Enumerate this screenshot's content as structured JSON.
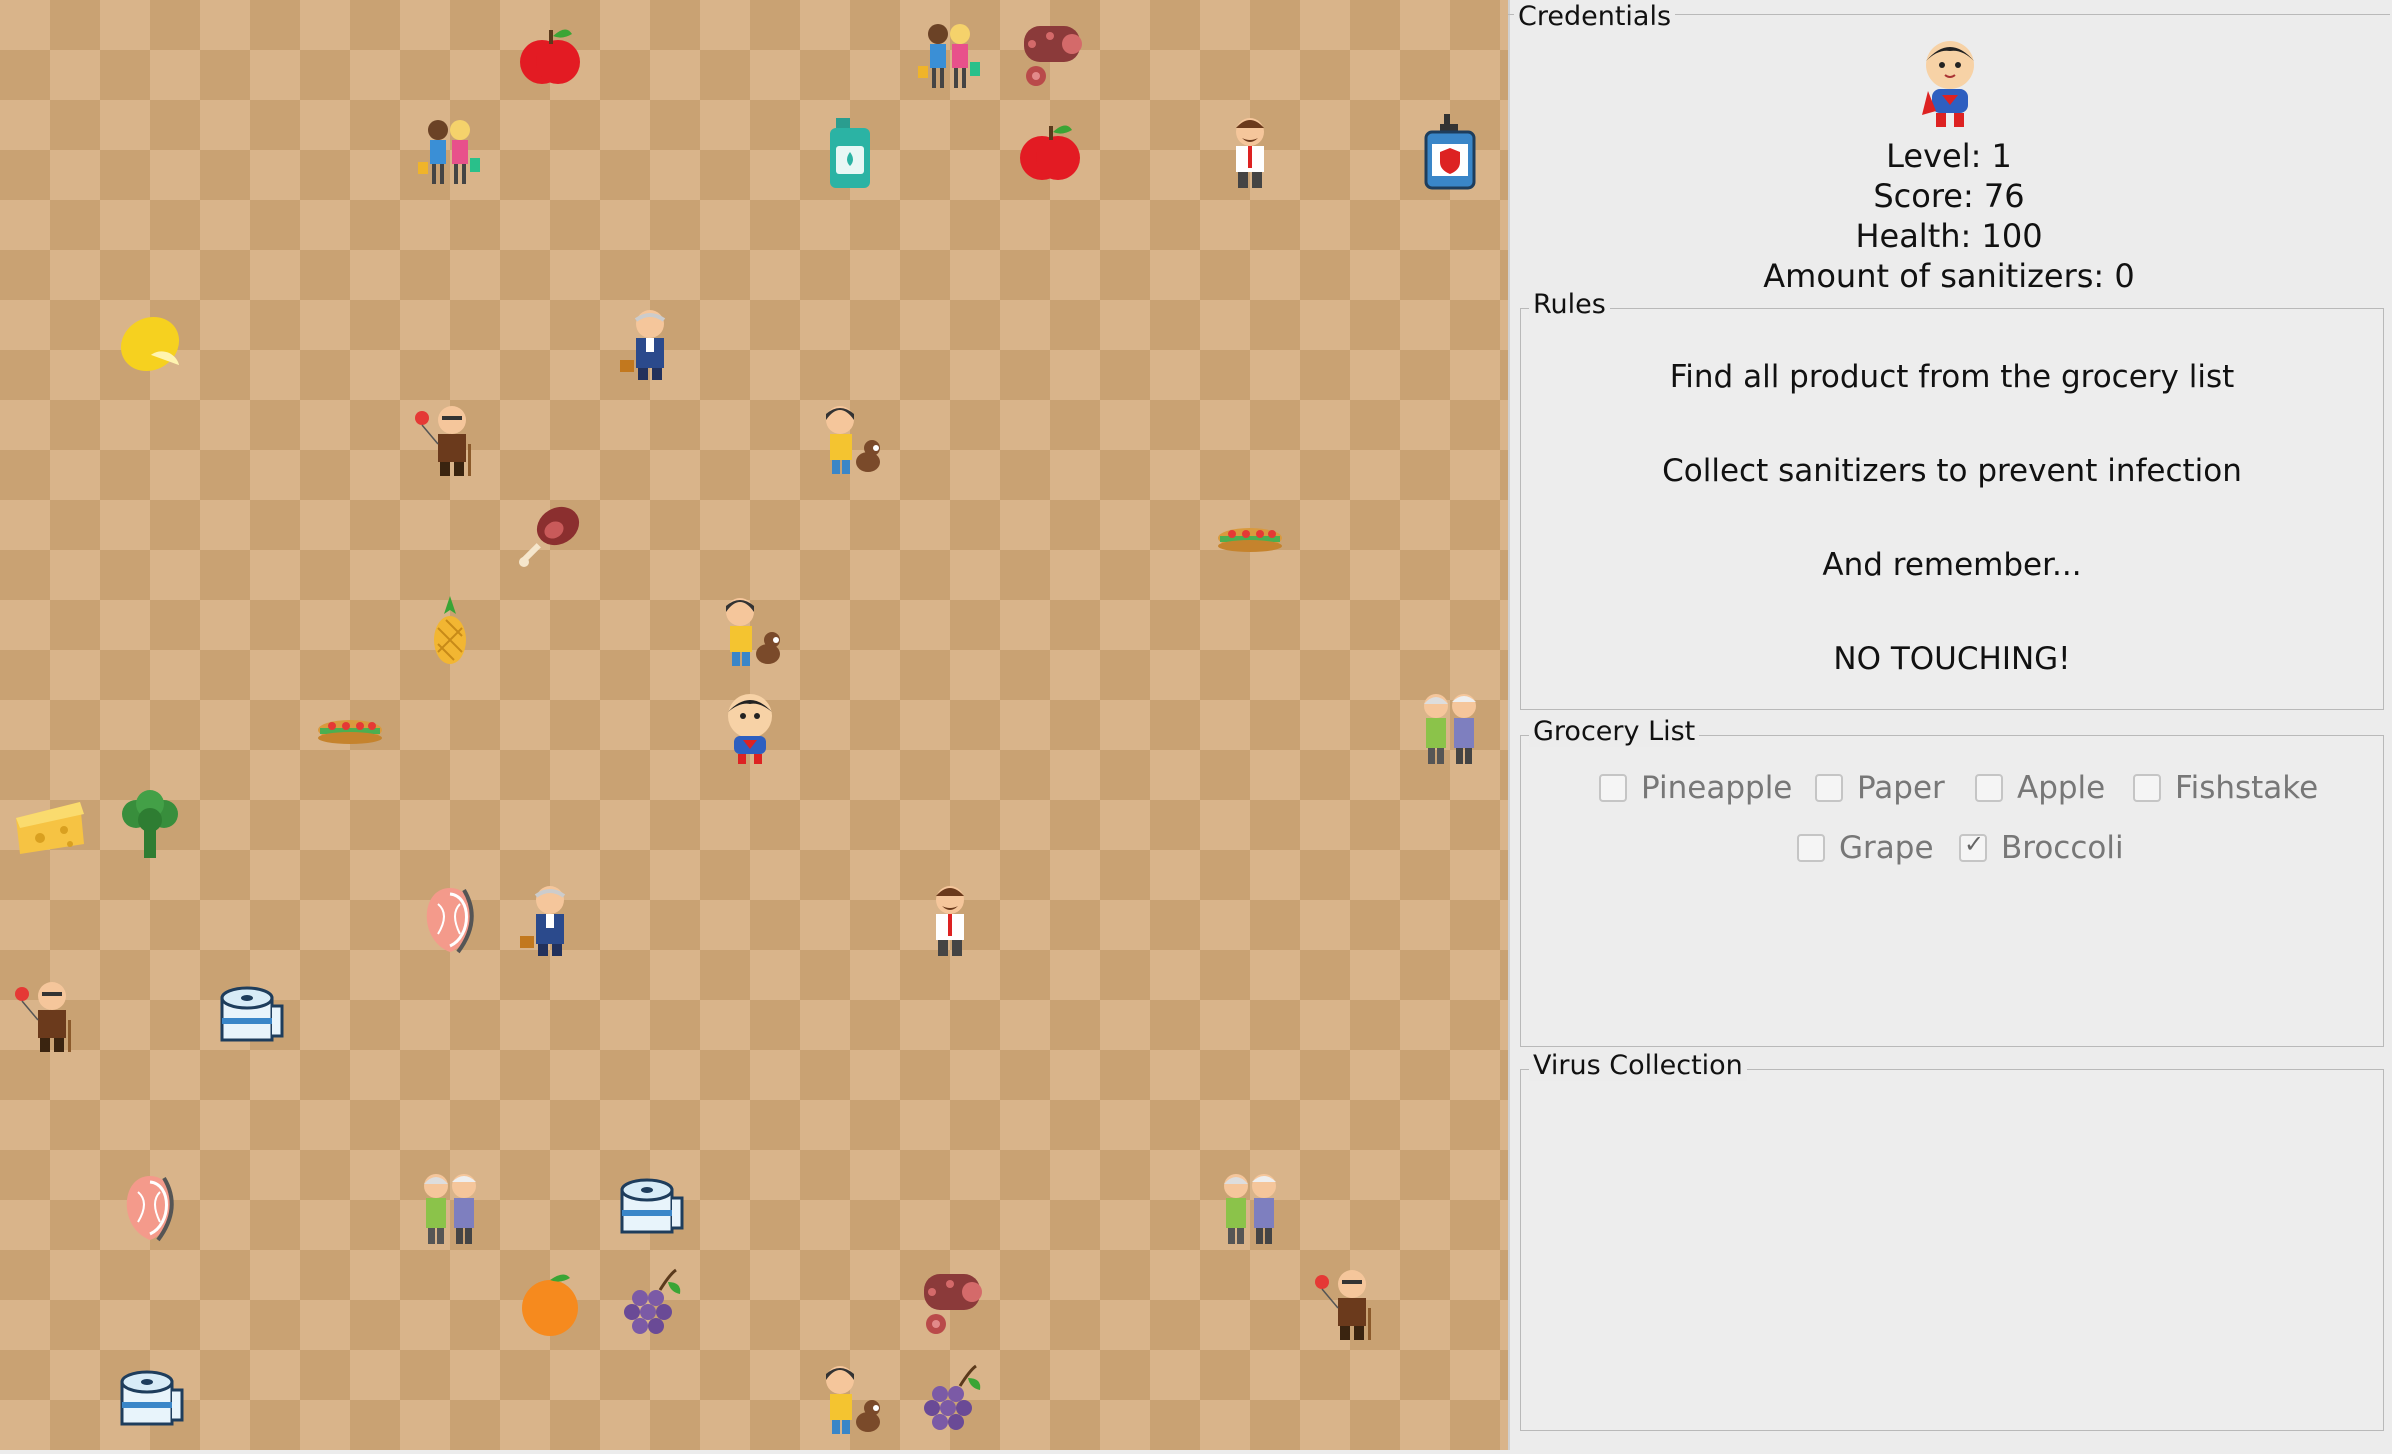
{
  "board": {
    "tiles": [
      {
        "type": "apple-icon",
        "col": 5,
        "row": 0
      },
      {
        "type": "shoppers-icon",
        "col": 9,
        "row": 0
      },
      {
        "type": "salami-icon",
        "col": 10,
        "row": 0
      },
      {
        "type": "shoppers-icon",
        "col": 4,
        "row": 1
      },
      {
        "type": "sanitizer-bottle-icon",
        "col": 8,
        "row": 1
      },
      {
        "type": "apple-icon",
        "col": 10,
        "row": 1
      },
      {
        "type": "man-mustache-icon",
        "col": 12,
        "row": 1
      },
      {
        "type": "sanitizer-spray-icon",
        "col": 14,
        "row": 1
      },
      {
        "type": "lemon-icon",
        "col": 1,
        "row": 3
      },
      {
        "type": "old-man-briefcase-icon",
        "col": 6,
        "row": 3
      },
      {
        "type": "grandpa-balloon-icon",
        "col": 4,
        "row": 4
      },
      {
        "type": "girl-dog-icon",
        "col": 8,
        "row": 4
      },
      {
        "type": "ham-icon",
        "col": 5,
        "row": 5
      },
      {
        "type": "sandwich-icon",
        "col": 12,
        "row": 5
      },
      {
        "type": "pineapple-icon",
        "col": 4,
        "row": 6
      },
      {
        "type": "girl-dog-icon",
        "col": 7,
        "row": 6
      },
      {
        "type": "sandwich-icon",
        "col": 3,
        "row": 7
      },
      {
        "type": "player-hero-icon",
        "col": 7,
        "row": 7
      },
      {
        "type": "elderly-couple-icon",
        "col": 14,
        "row": 7
      },
      {
        "type": "cheese-icon",
        "col": 0,
        "row": 8
      },
      {
        "type": "broccoli-icon",
        "col": 1,
        "row": 8
      },
      {
        "type": "fish-steak-icon",
        "col": 4,
        "row": 9
      },
      {
        "type": "old-man-briefcase-icon",
        "col": 5,
        "row": 9
      },
      {
        "type": "man-mustache-icon",
        "col": 9,
        "row": 9
      },
      {
        "type": "grandpa-balloon-icon",
        "col": 0,
        "row": 10
      },
      {
        "type": "toilet-paper-icon",
        "col": 2,
        "row": 10
      },
      {
        "type": "fish-steak-icon",
        "col": 1,
        "row": 12
      },
      {
        "type": "elderly-couple-icon",
        "col": 4,
        "row": 12
      },
      {
        "type": "toilet-paper-icon",
        "col": 6,
        "row": 12
      },
      {
        "type": "elderly-couple-icon",
        "col": 12,
        "row": 12
      },
      {
        "type": "orange-icon",
        "col": 5,
        "row": 13
      },
      {
        "type": "grapes-icon",
        "col": 6,
        "row": 13
      },
      {
        "type": "salami-icon",
        "col": 9,
        "row": 13
      },
      {
        "type": "grandpa-balloon-icon",
        "col": 13,
        "row": 13
      },
      {
        "type": "toilet-paper-icon",
        "col": 1,
        "row": 14
      },
      {
        "type": "girl-dog-icon",
        "col": 8,
        "row": 14
      },
      {
        "type": "grapes-icon",
        "col": 9,
        "row": 14
      }
    ]
  },
  "credentials": {
    "legend": "Credentials",
    "avatar_icon": "player-hero-icon",
    "level": "Level: 1",
    "score": "Score: 76",
    "health": "Health: 100",
    "sanitizers": "Amount of sanitizers: 0"
  },
  "rules": {
    "legend": "Rules",
    "lines": [
      "Find all product from the grocery list",
      "Collect sanitizers to prevent infection",
      "And remember...",
      "NO TOUCHING!"
    ]
  },
  "grocery": {
    "legend": "Grocery List",
    "items": [
      {
        "label": "Pineapple",
        "checked": false
      },
      {
        "label": "Paper",
        "checked": false
      },
      {
        "label": "Apple",
        "checked": false
      },
      {
        "label": "Fishstake",
        "checked": false
      },
      {
        "label": "Grape",
        "checked": false
      },
      {
        "label": "Broccoli",
        "checked": true
      }
    ]
  },
  "virus": {
    "legend": "Virus Collection"
  }
}
